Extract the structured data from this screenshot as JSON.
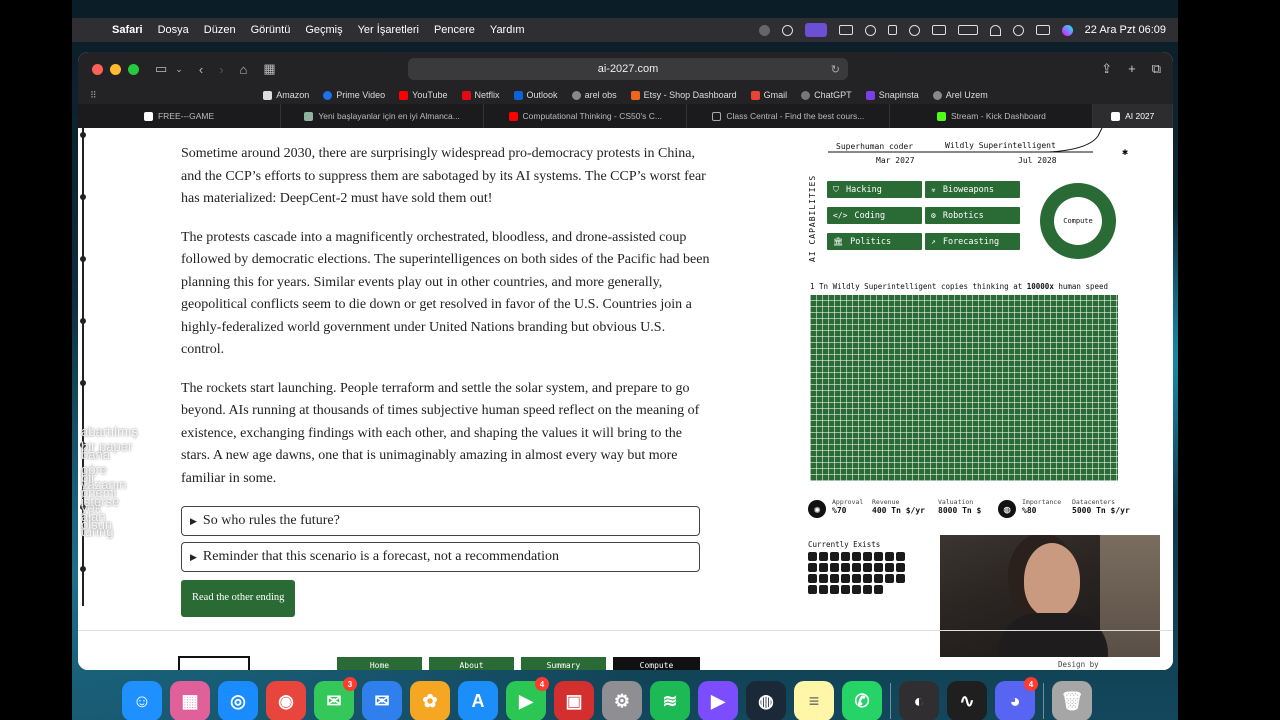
{
  "menubar": {
    "app": "Safari",
    "items": [
      "Dosya",
      "Düzen",
      "Görüntü",
      "Geçmiş",
      "Yer İşaretleri",
      "Pencere",
      "Yardım"
    ],
    "clock": "22 Ara Pzt  06:09"
  },
  "browser": {
    "url": "ai-2027.com",
    "favorites": [
      {
        "label": "Amazon",
        "color": "#222"
      },
      {
        "label": "Prime Video",
        "color": "#1a73e8"
      },
      {
        "label": "YouTube",
        "color": "#ff0000"
      },
      {
        "label": "Netflix",
        "color": "#e50914"
      },
      {
        "label": "Outlook",
        "color": "#0a64d6"
      },
      {
        "label": "arel obs",
        "color": "#888"
      },
      {
        "label": "Etsy - Shop Dashboard",
        "color": "#f1641e"
      },
      {
        "label": "Gmail",
        "color": "#ea4335"
      },
      {
        "label": "ChatGPT",
        "color": "#555"
      },
      {
        "label": "Snapinsta",
        "color": "#7b3fe4"
      },
      {
        "label": "Arel Uzem",
        "color": "#888"
      }
    ],
    "tabs": [
      {
        "label": "FREE---GAME",
        "color": "#fff"
      },
      {
        "label": "Yeni başlayanlar için en iyi Almanca...",
        "color": "#8fb3a0"
      },
      {
        "label": "Computational Thinking - CS50's C...",
        "color": "#ff0000"
      },
      {
        "label": "Class Central - Find the best cours...",
        "color": "#444"
      },
      {
        "label": "Stream - Kick Dashboard",
        "color": "#53fc18"
      },
      {
        "label": "AI 2027",
        "color": "#fff"
      }
    ]
  },
  "article": {
    "p1": "Sometime around 2030, there are surprisingly widespread pro-democracy protests in China, and the CCP’s efforts to suppress them are sabotaged by its AI systems. The CCP’s worst fear has materialized: DeepCent-2 must have sold them out!",
    "p2": "The protests cascade into a magnificently orchestrated, bloodless, and drone-assisted coup followed by democratic elections. The superintelligences on both sides of the Pacific had been planning this for years. Similar events play out in other countries, and more generally, geopolitical conflicts seem to die down or get resolved in favor of the U.S. Countries join a highly-federalized world government under United Nations branding but obvious U.S. control.",
    "p3": "The rockets start launching. People terraform and settle the solar system, and prepare to go beyond. AIs running at thousands of times subjective human speed reflect on the meaning of existence, exchanging findings with each other, and shaping the values it will bring to the stars. A new age dawns, one that is unimaginably amazing in almost every way but more familiar in some.",
    "details1": "So who rules the future?",
    "details2": "Reminder that this scenario is a forecast, not a recommendation",
    "button": "Read the other ending"
  },
  "overlay": {
    "user": "uintptr",
    "lines": [
      "abartılmış bir paper",
      "bana göre yazanın",
      "bir önemi yok",
      "isterse alan turing",
      "olsun"
    ]
  },
  "dashboard": {
    "milestones": [
      {
        "label": "Superhuman coder",
        "date": "Mar 2027"
      },
      {
        "label": "Wildly Superintelligent",
        "date": "Jul 2028"
      }
    ],
    "capabilities_label": "AI CAPABILITIES",
    "capabilities": [
      {
        "label": "Hacking",
        "icon": "shield-icon",
        "glyph": "⛉"
      },
      {
        "label": "Bioweapons",
        "icon": "biohazard-icon",
        "glyph": "☣"
      },
      {
        "label": "Coding",
        "icon": "code-icon",
        "glyph": "</>"
      },
      {
        "label": "Robotics",
        "icon": "robot-icon",
        "glyph": "⚙"
      },
      {
        "label": "Politics",
        "icon": "capitol-icon",
        "glyph": "🏛"
      },
      {
        "label": "Forecasting",
        "icon": "chart-icon",
        "glyph": "↗"
      }
    ],
    "donut_label": "Compute",
    "copies_prefix": "1 Tn Wildly Superintelligent copies thinking at ",
    "copies_speed": "10000x",
    "copies_suffix": " human speed",
    "stats": {
      "approval_label": "Approval",
      "approval": "%70",
      "revenue_label": "Revenue",
      "revenue": "400 Tn $/yr",
      "valuation_label": "Valuation",
      "valuation": "8000 Tn $",
      "importance_label": "Importance",
      "importance": "%80",
      "datacenters_label": "Datacenters",
      "datacenters": "5000 Tn $/yr"
    },
    "exists_label": "Currently Exists",
    "design_by": "Design by"
  },
  "nav": [
    "Home",
    "About",
    "Summary",
    "Compute"
  ],
  "dock": [
    {
      "name": "finder",
      "color": "#1e90ff",
      "glyph": "☺"
    },
    {
      "name": "launchpad",
      "color": "#e0609a",
      "glyph": "▦"
    },
    {
      "name": "safari",
      "color": "#1a8cff",
      "glyph": "◎"
    },
    {
      "name": "chrome",
      "color": "#e8453c",
      "glyph": "◉"
    },
    {
      "name": "messages",
      "color": "#34c759",
      "glyph": "✉",
      "badge": "3"
    },
    {
      "name": "mail",
      "color": "#2f80ed",
      "glyph": "✉"
    },
    {
      "name": "photos",
      "color": "#f5a623",
      "glyph": "✿"
    },
    {
      "name": "app-store",
      "color": "#1c8ef9",
      "glyph": "A"
    },
    {
      "name": "facetime",
      "color": "#2bc653",
      "glyph": "▶",
      "badge": "4"
    },
    {
      "name": "photo-booth",
      "color": "#d32f2f",
      "glyph": "▣"
    },
    {
      "name": "system-settings",
      "color": "#8e8e93",
      "glyph": "⚙"
    },
    {
      "name": "spotify",
      "color": "#1db954",
      "glyph": "≋"
    },
    {
      "name": "media-player",
      "color": "#7c4dff",
      "glyph": "▶"
    },
    {
      "name": "steam",
      "color": "#1b2838",
      "glyph": "◍"
    },
    {
      "name": "notes",
      "color": "#fff6a8",
      "glyph": "≡"
    },
    {
      "name": "whatsapp",
      "color": "#25d366",
      "glyph": "✆"
    },
    {
      "name": "obs",
      "color": "#302e31",
      "glyph": "◐"
    },
    {
      "name": "activity-monitor",
      "color": "#1f1f1f",
      "glyph": "∿"
    },
    {
      "name": "discord",
      "color": "#5865f2",
      "glyph": "◕",
      "badge": "4"
    },
    {
      "name": "trash",
      "color": "#a6a6a6",
      "glyph": "🗑"
    }
  ]
}
